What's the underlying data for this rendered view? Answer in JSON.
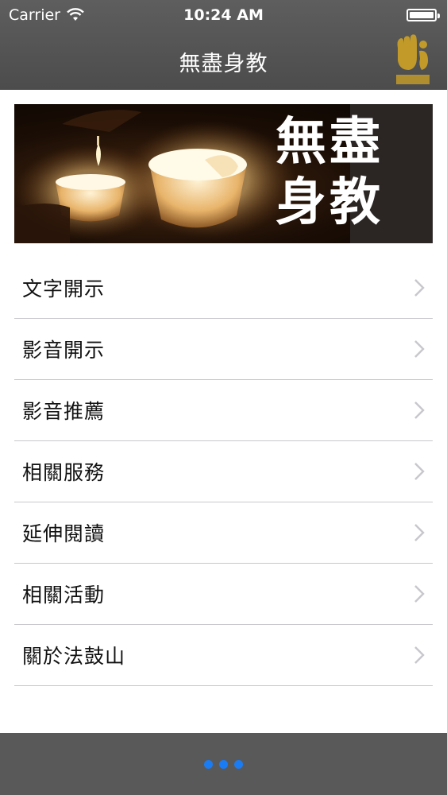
{
  "status_bar": {
    "carrier": "Carrier",
    "time": "10:24 AM"
  },
  "nav": {
    "title": "無盡身教"
  },
  "banner": {
    "line1": "無盡",
    "line2": "身教"
  },
  "menu": [
    {
      "label": "文字開示"
    },
    {
      "label": "影音開示"
    },
    {
      "label": "影音推薦"
    },
    {
      "label": "相關服務"
    },
    {
      "label": "延伸閱讀"
    },
    {
      "label": "相關活動"
    },
    {
      "label": "關於法鼓山"
    }
  ],
  "colors": {
    "nav_bg": "#555555",
    "chevron": "#c7c7cc",
    "dot_accent": "#1a7cf5"
  }
}
